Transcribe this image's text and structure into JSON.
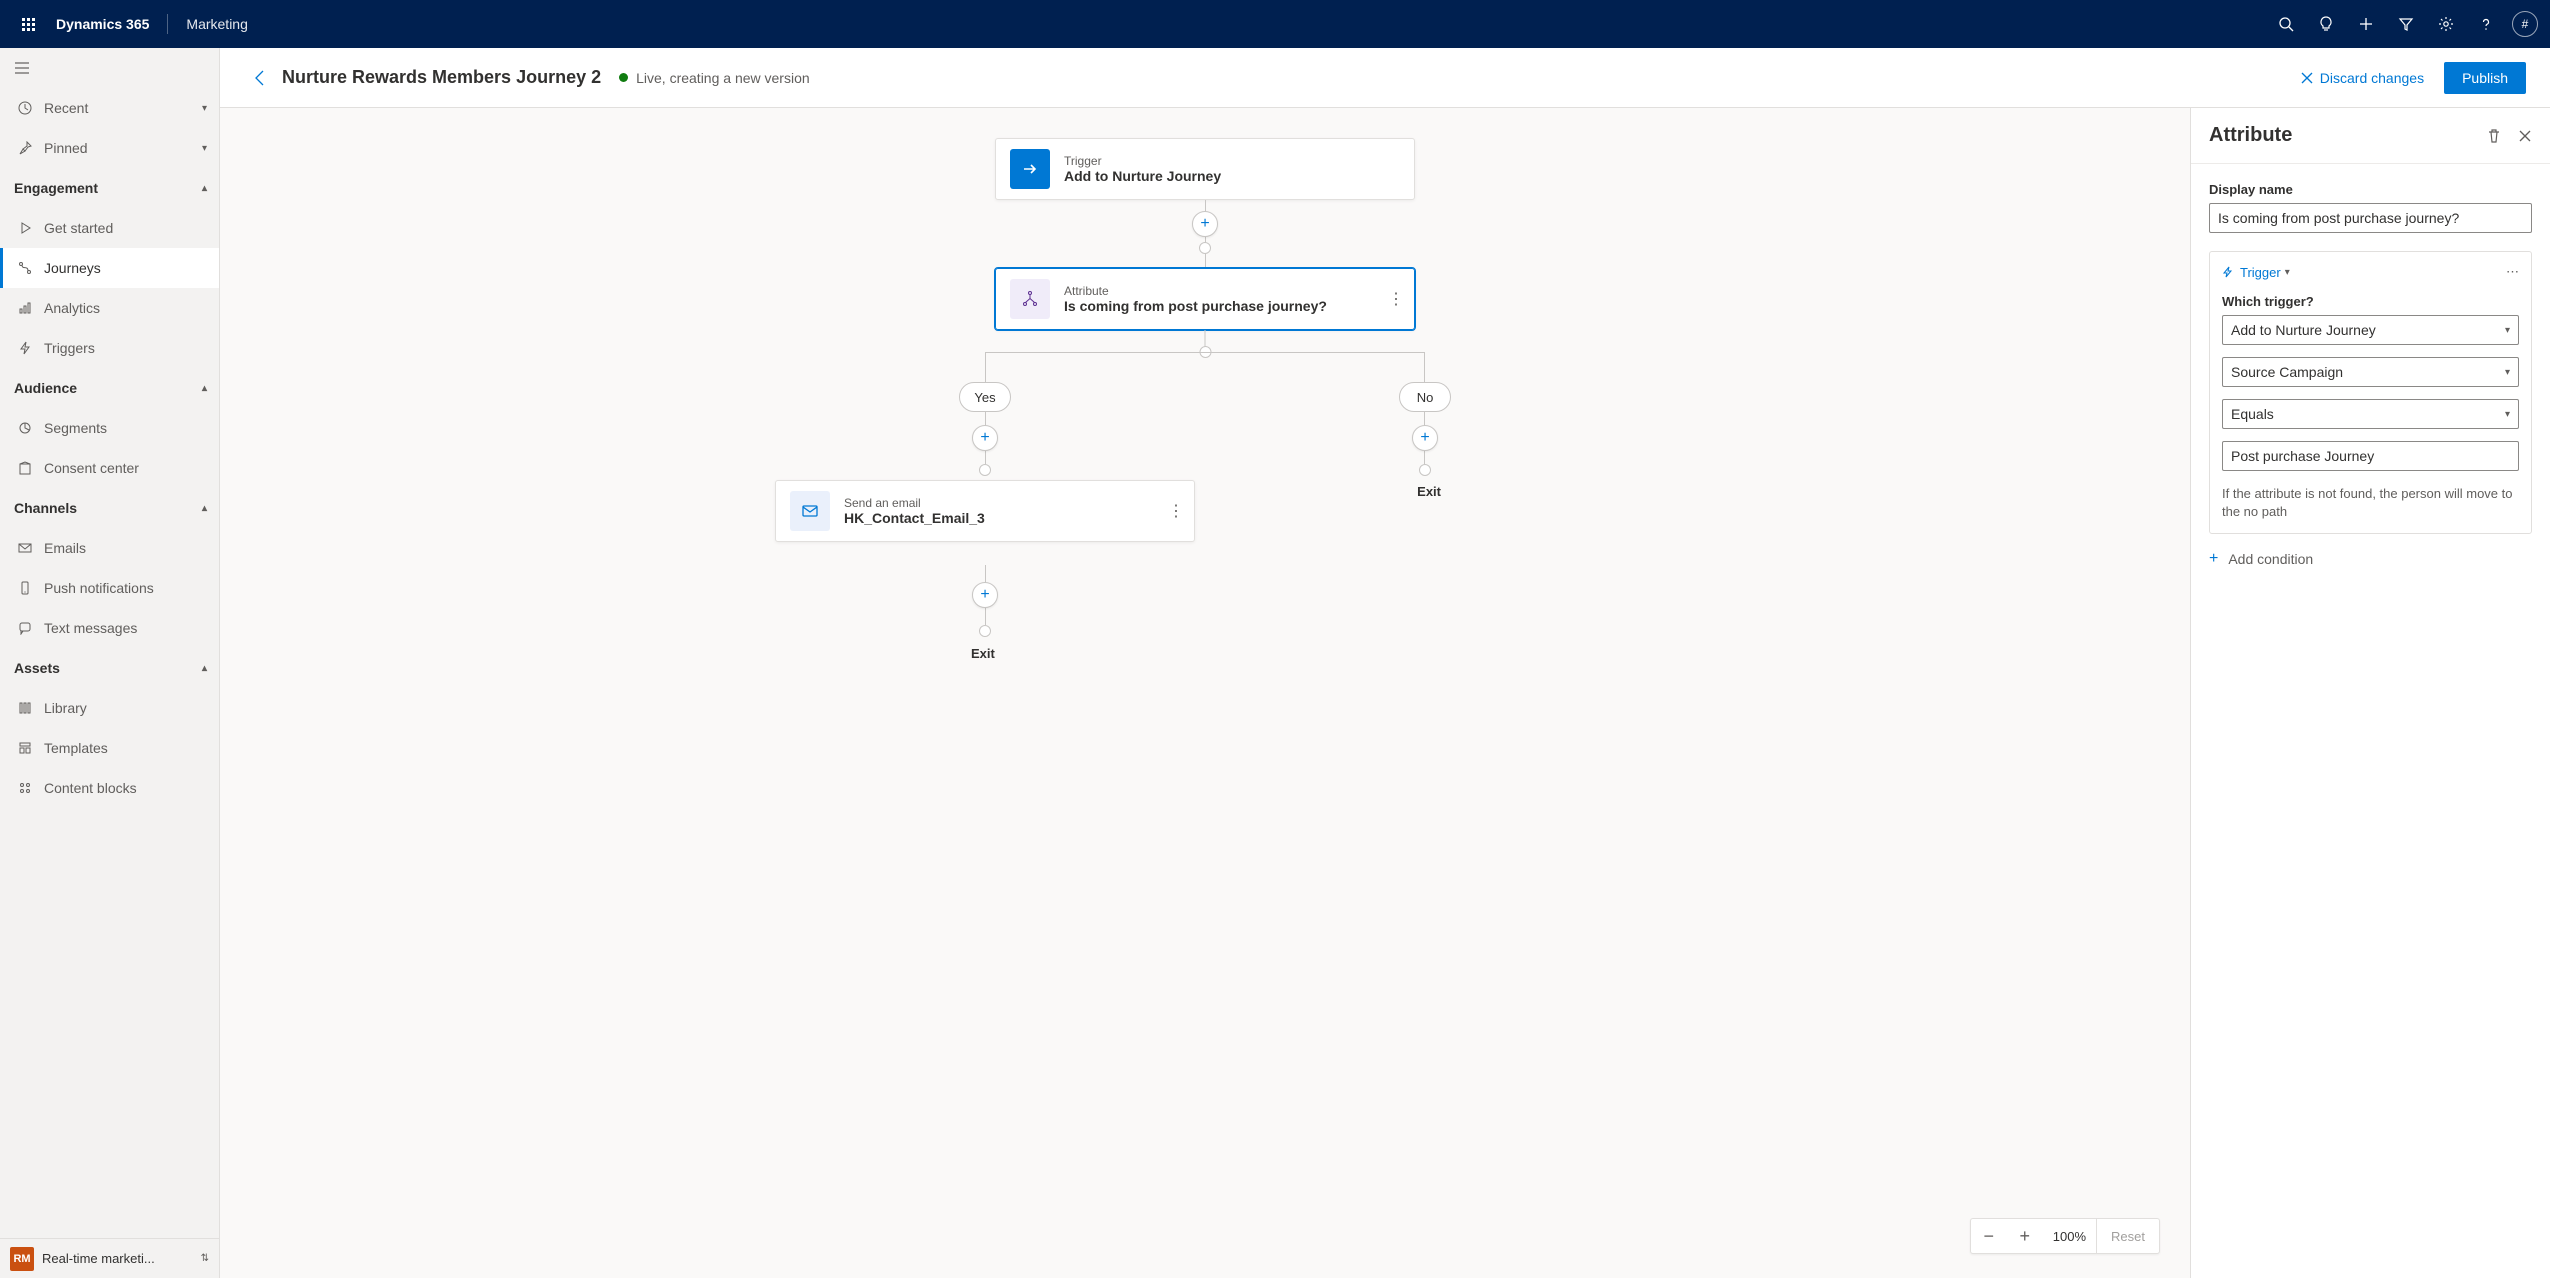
{
  "topbar": {
    "brand": "Dynamics 365",
    "module": "Marketing",
    "avatar": "#"
  },
  "sidebar": {
    "recent": "Recent",
    "pinned": "Pinned",
    "engagement": {
      "title": "Engagement",
      "get_started": "Get started",
      "journeys": "Journeys",
      "analytics": "Analytics",
      "triggers": "Triggers"
    },
    "audience": {
      "title": "Audience",
      "segments": "Segments",
      "consent": "Consent center"
    },
    "channels": {
      "title": "Channels",
      "emails": "Emails",
      "push": "Push notifications",
      "text": "Text messages"
    },
    "assets": {
      "title": "Assets",
      "library": "Library",
      "templates": "Templates",
      "content_blocks": "Content blocks"
    },
    "footer": {
      "badge": "RM",
      "label": "Real-time marketi..."
    }
  },
  "cmdbar": {
    "title": "Nurture Rewards Members Journey 2",
    "status": "Live, creating a new version",
    "discard": "Discard changes",
    "publish": "Publish"
  },
  "flow": {
    "trigger": {
      "sub": "Trigger",
      "main": "Add to Nurture Journey"
    },
    "attribute": {
      "sub": "Attribute",
      "main": "Is coming from post purchase journey?"
    },
    "yes": "Yes",
    "no": "No",
    "exit": "Exit",
    "email": {
      "sub": "Send an email",
      "main": "HK_Contact_Email_3"
    }
  },
  "zoom": {
    "value": "100%",
    "reset": "Reset"
  },
  "panel": {
    "title": "Attribute",
    "display_name_label": "Display name",
    "display_name_value": "Is coming from post purchase journey?",
    "condition_type": "Trigger",
    "which_trigger_label": "Which trigger?",
    "trigger_select": "Add to Nurture Journey",
    "field_select": "Source Campaign",
    "operator_select": "Equals",
    "value_text": "Post purchase Journey",
    "help_text": "If the attribute is not found, the person will move to the no path",
    "add_condition": "Add condition"
  }
}
